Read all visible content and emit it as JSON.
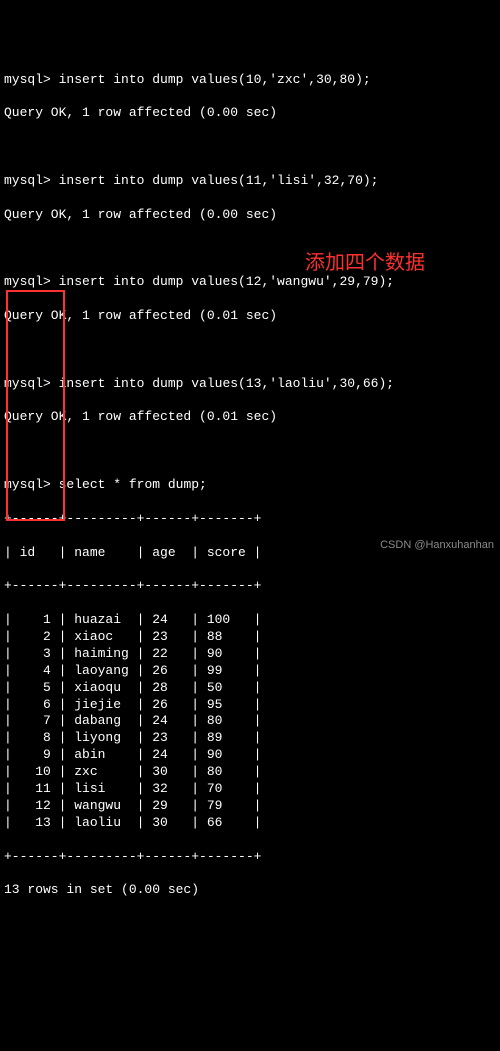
{
  "prompt": "mysql>",
  "inserts": [
    {
      "sql": "insert into dump values(10,'zxc',30,80);",
      "result": "Query OK, 1 row affected (0.00 sec)"
    },
    {
      "sql": "insert into dump values(11,'lisi',32,70);",
      "result": "Query OK, 1 row affected (0.00 sec)"
    },
    {
      "sql": "insert into dump values(12,'wangwu',29,79);",
      "result": "Query OK, 1 row affected (0.01 sec)"
    },
    {
      "sql": "insert into dump values(13,'laoliu',30,66);",
      "result": "Query OK, 1 row affected (0.01 sec)"
    }
  ],
  "select": {
    "sql": "select * from dump;",
    "border_top": "+------+---------+------+-------+",
    "header": "| id   | name    | age  | score |",
    "border_mid": "+------+---------+------+-------+",
    "rows": [
      {
        "id": 1,
        "name": "huazai",
        "age": 24,
        "score": 100
      },
      {
        "id": 2,
        "name": "xiaoc",
        "age": 23,
        "score": 88
      },
      {
        "id": 3,
        "name": "haiming",
        "age": 22,
        "score": 90
      },
      {
        "id": 4,
        "name": "laoyang",
        "age": 26,
        "score": 99
      },
      {
        "id": 5,
        "name": "xiaoqu",
        "age": 28,
        "score": 50
      },
      {
        "id": 6,
        "name": "jiejie",
        "age": 26,
        "score": 95
      },
      {
        "id": 7,
        "name": "dabang",
        "age": 24,
        "score": 80
      },
      {
        "id": 8,
        "name": "liyong",
        "age": 23,
        "score": 89
      },
      {
        "id": 9,
        "name": "abin",
        "age": 24,
        "score": 90
      },
      {
        "id": 10,
        "name": "zxc",
        "age": 30,
        "score": 80
      },
      {
        "id": 11,
        "name": "lisi",
        "age": 32,
        "score": 70
      },
      {
        "id": 12,
        "name": "wangwu",
        "age": 29,
        "score": 79
      },
      {
        "id": 13,
        "name": "laoliu",
        "age": 30,
        "score": 66
      }
    ],
    "border_bot": "+------+---------+------+-------+",
    "summary": "13 rows in set (0.00 sec)"
  },
  "annotation": {
    "label": "添加四个数据"
  },
  "watermark": "CSDN @Hanxuhanhan"
}
